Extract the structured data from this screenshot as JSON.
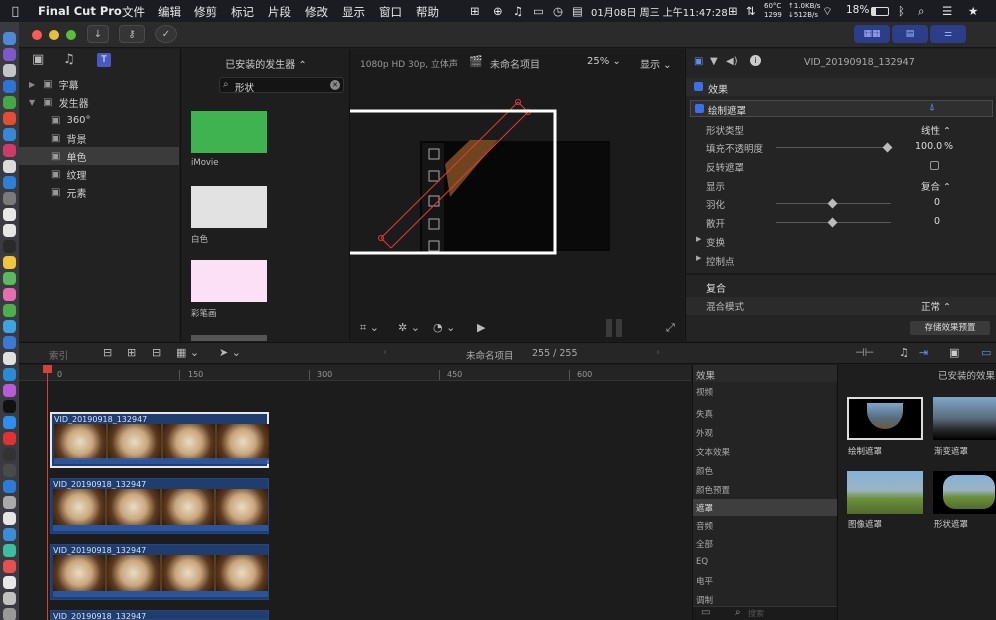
{
  "menubar": {
    "app_name": "Final Cut Pro",
    "menus": [
      "文件",
      "编辑",
      "修剪",
      "标记",
      "片段",
      "修改",
      "显示",
      "窗口",
      "帮助"
    ],
    "temp": "60°C",
    "rpm": "1299",
    "net_up": "↑1.0KB/s",
    "net_down": "↓512B/s",
    "datetime": "01月08日 周三 上午11:47:28",
    "battery": "18%"
  },
  "toolbar": {
    "import_icon": "↓",
    "key_icon": "⚷",
    "check_icon": "✓"
  },
  "sidebar": {
    "items": [
      {
        "label": "字幕"
      },
      {
        "label": "发生器"
      },
      {
        "label": "360°"
      },
      {
        "label": "背景"
      },
      {
        "label": "单色"
      },
      {
        "label": "纹理"
      },
      {
        "label": "元素"
      }
    ]
  },
  "generators": {
    "header": "已安装的发生器",
    "search_value": "形状",
    "items": [
      {
        "label": "iMovie",
        "color": "#3fb34f"
      },
      {
        "label": "白色",
        "color": "#e2e2e2"
      },
      {
        "label": "彩笔画",
        "color": "#fbe0f6"
      }
    ]
  },
  "viewer": {
    "format": "1080p HD 30p, 立体声",
    "project": "未命名项目",
    "zoom": "25%",
    "display": "显示"
  },
  "inspector": {
    "clip_name": "VID_20190918_132947",
    "effects_label": "效果",
    "effect_name": "绘制遮罩",
    "props": [
      {
        "label": "形状类型",
        "value": "线性"
      },
      {
        "label": "填充不透明度",
        "value": "100.0",
        "unit": "%"
      },
      {
        "label": "反转遮罩",
        "value": ""
      },
      {
        "label": "显示",
        "value": "复合"
      },
      {
        "label": "羽化",
        "value": "0"
      },
      {
        "label": "散开",
        "value": "0"
      }
    ],
    "transform": "变换",
    "control_points": "控制点",
    "composite": "复合",
    "blend_mode": "混合模式",
    "blend_value": "正常",
    "save_preset": "存储效果预置"
  },
  "timeline": {
    "index": "索引",
    "project": "未命名项目",
    "position": "255 / 255",
    "ruler": [
      "0",
      "150",
      "300",
      "450",
      "600"
    ],
    "clips": [
      {
        "name": "VID_20190918_132947"
      },
      {
        "name": "VID_20190918_132947"
      },
      {
        "name": "VID_20190918_132947"
      },
      {
        "name": "VID_20190918_132947"
      }
    ]
  },
  "effects_browser": {
    "header": "效果",
    "installed": "已安装的效果",
    "categories": [
      "视频",
      "失真",
      "外观",
      "文本效果",
      "颜色",
      "颜色预置",
      "遮罩",
      "音频",
      "全部",
      "EQ",
      "电平",
      "调制"
    ],
    "selected_category": "遮罩",
    "thumbs": [
      {
        "label": "绘制遮罩"
      },
      {
        "label": "渐变遮罩"
      },
      {
        "label": "图像遮罩"
      },
      {
        "label": "形状遮罩"
      }
    ],
    "search_placeholder": "搜索"
  }
}
